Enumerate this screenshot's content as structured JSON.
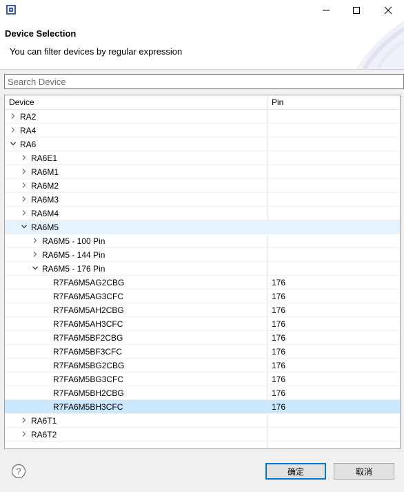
{
  "window": {
    "title_bar_text": "",
    "minimize_icon": "minimize-icon",
    "maximize_icon": "maximize-icon",
    "close_icon": "close-icon"
  },
  "header": {
    "title": "Device Selection",
    "message": "You can filter devices by regular expression"
  },
  "search": {
    "placeholder": "Search Device",
    "value": ""
  },
  "tree": {
    "columns": [
      "Device",
      "Pin"
    ],
    "rows": [
      {
        "label": "RA2",
        "level": 0,
        "state": "collapsed",
        "pin": ""
      },
      {
        "label": "RA4",
        "level": 0,
        "state": "collapsed",
        "pin": ""
      },
      {
        "label": "RA6",
        "level": 0,
        "state": "expanded",
        "pin": ""
      },
      {
        "label": "RA6E1",
        "level": 1,
        "state": "collapsed",
        "pin": ""
      },
      {
        "label": "RA6M1",
        "level": 1,
        "state": "collapsed",
        "pin": ""
      },
      {
        "label": "RA6M2",
        "level": 1,
        "state": "collapsed",
        "pin": ""
      },
      {
        "label": "RA6M3",
        "level": 1,
        "state": "collapsed",
        "pin": ""
      },
      {
        "label": "RA6M4",
        "level": 1,
        "state": "collapsed",
        "pin": ""
      },
      {
        "label": "RA6M5",
        "level": 1,
        "state": "expanded",
        "pin": "",
        "highlight": "soft"
      },
      {
        "label": "RA6M5 - 100 Pin",
        "level": 2,
        "state": "collapsed",
        "pin": ""
      },
      {
        "label": "RA6M5 - 144 Pin",
        "level": 2,
        "state": "collapsed",
        "pin": ""
      },
      {
        "label": "RA6M5 - 176 Pin",
        "level": 2,
        "state": "expanded",
        "pin": ""
      },
      {
        "label": "R7FA6M5AG2CBG",
        "level": 3,
        "state": "leaf",
        "pin": "176"
      },
      {
        "label": "R7FA6M5AG3CFC",
        "level": 3,
        "state": "leaf",
        "pin": "176"
      },
      {
        "label": "R7FA6M5AH2CBG",
        "level": 3,
        "state": "leaf",
        "pin": "176"
      },
      {
        "label": "R7FA6M5AH3CFC",
        "level": 3,
        "state": "leaf",
        "pin": "176"
      },
      {
        "label": "R7FA6M5BF2CBG",
        "level": 3,
        "state": "leaf",
        "pin": "176"
      },
      {
        "label": "R7FA6M5BF3CFC",
        "level": 3,
        "state": "leaf",
        "pin": "176"
      },
      {
        "label": "R7FA6M5BG2CBG",
        "level": 3,
        "state": "leaf",
        "pin": "176"
      },
      {
        "label": "R7FA6M5BG3CFC",
        "level": 3,
        "state": "leaf",
        "pin": "176"
      },
      {
        "label": "R7FA6M5BH2CBG",
        "level": 3,
        "state": "leaf",
        "pin": "176"
      },
      {
        "label": "R7FA6M5BH3CFC",
        "level": 3,
        "state": "leaf",
        "pin": "176",
        "highlight": "selected"
      },
      {
        "label": "RA6T1",
        "level": 1,
        "state": "collapsed",
        "pin": ""
      },
      {
        "label": "RA6T2",
        "level": 1,
        "state": "collapsed",
        "pin": ""
      }
    ]
  },
  "footer": {
    "help_icon": "help-icon",
    "ok_label": "确定",
    "cancel_label": "取消"
  },
  "colors": {
    "selection": "#cce8ff",
    "soft_selection": "#e5f3ff",
    "default_button_border": "#0078d7"
  }
}
